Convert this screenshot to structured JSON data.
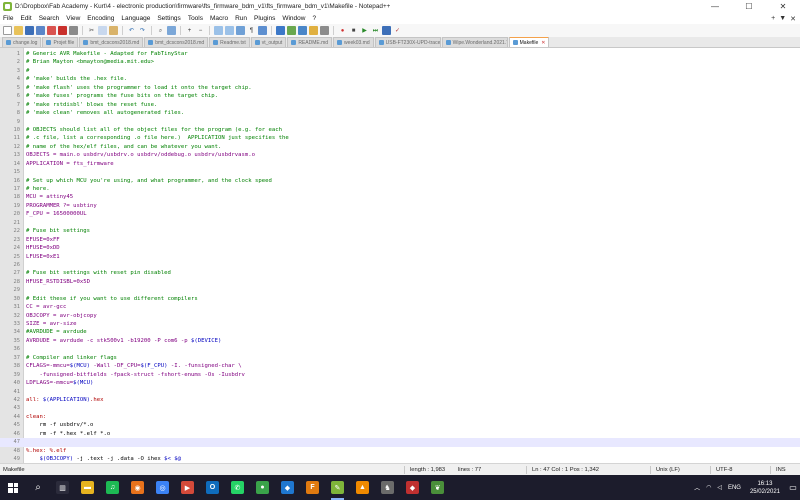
{
  "window": {
    "title": "D:\\Dropbox\\Fab Academy - Kurt\\4 - electronic production\\firmware\\fts_firmware_bdm_v1\\fts_firmware_bdm_v1\\Makefile - Notepad++",
    "minimize": "—",
    "maximize": "☐",
    "close": "✕"
  },
  "menu": {
    "items": [
      "File",
      "Edit",
      "Search",
      "View",
      "Encoding",
      "Language",
      "Settings",
      "Tools",
      "Macro",
      "Run",
      "Plugins",
      "Window",
      "?"
    ],
    "right_plus": "+",
    "right_down": "▼",
    "right_close": "✕"
  },
  "tabs": [
    {
      "label": "change.log",
      "active": false
    },
    {
      "label": "Projet file",
      "active": false
    },
    {
      "label": "bmt_dcscons2018.md",
      "active": false
    },
    {
      "label": "bmt_dcscons2018.md",
      "active": false
    },
    {
      "label": "Readme.txt",
      "active": false
    },
    {
      "label": "vt_output",
      "active": false
    },
    {
      "label": "README.md",
      "active": false
    },
    {
      "label": "week03.md",
      "active": false
    },
    {
      "label": "USB-FT230X-UPD-traces.png (2).md",
      "active": false
    },
    {
      "label": "Wipe.Wonderland.2021.720p.WEBRip.800MB.x264-GalaxyRG.txt",
      "active": false
    },
    {
      "label": "Makefile",
      "active": true
    }
  ],
  "code_lines": [
    {
      "n": "1",
      "text": "# Generic AVR Makefile - Adapted for FabTinyStar",
      "kind": "comment"
    },
    {
      "n": "2",
      "text": "# Brian Mayton <bmayton@media.mit.edu>",
      "kind": "comment"
    },
    {
      "n": "3",
      "text": "#",
      "kind": "comment"
    },
    {
      "n": "4",
      "text": "# 'make' builds the .hex file.",
      "kind": "comment"
    },
    {
      "n": "5",
      "text": "# 'make flash' uses the programmer to load it onto the target chip.",
      "kind": "comment"
    },
    {
      "n": "6",
      "text": "# 'make fuses' programs the fuse bits on the target chip.",
      "kind": "comment"
    },
    {
      "n": "7",
      "text": "# 'make rstdisbl' blows the reset fuse.",
      "kind": "comment"
    },
    {
      "n": "8",
      "text": "# 'make clean' removes all autogenerated files.",
      "kind": "comment"
    },
    {
      "n": "9",
      "text": "",
      "kind": "normal"
    },
    {
      "n": "10",
      "text": "# OBJECTS should list all of the object files for the program (e.g. for each",
      "kind": "comment"
    },
    {
      "n": "11",
      "text": "# .c file, list a corresponding .o file here.)  APPLICATION just specifies the",
      "kind": "comment"
    },
    {
      "n": "12",
      "text": "# name of the hex/elf files, and can be whatever you want.",
      "kind": "comment"
    },
    {
      "n": "13",
      "text": "OBJECTS = main.o usbdrv/usbdrv.o usbdrv/oddebug.o usbdrv/usbdrvasm.o",
      "kind": "var"
    },
    {
      "n": "14",
      "text": "APPLICATION = fts_firmware",
      "kind": "var"
    },
    {
      "n": "15",
      "text": "",
      "kind": "normal"
    },
    {
      "n": "16",
      "text": "# Set up which MCU you're using, and what programmer, and the clock speed",
      "kind": "comment"
    },
    {
      "n": "17",
      "text": "# here.",
      "kind": "comment"
    },
    {
      "n": "18",
      "text": "MCU = attiny45",
      "kind": "var"
    },
    {
      "n": "19",
      "text": "PROGRAMMER ?= usbtiny",
      "kind": "var"
    },
    {
      "n": "20",
      "text": "F_CPU = 16500000UL",
      "kind": "var"
    },
    {
      "n": "21",
      "text": "",
      "kind": "normal"
    },
    {
      "n": "22",
      "text": "# Fuse bit settings",
      "kind": "comment"
    },
    {
      "n": "23",
      "text": "EFUSE=0xFF",
      "kind": "var"
    },
    {
      "n": "24",
      "text": "HFUSE=0xDD",
      "kind": "var"
    },
    {
      "n": "25",
      "text": "LFUSE=0xE1",
      "kind": "var"
    },
    {
      "n": "26",
      "text": "",
      "kind": "normal"
    },
    {
      "n": "27",
      "text": "# Fuse bit settings with reset pin disabled",
      "kind": "comment"
    },
    {
      "n": "28",
      "text": "HFUSE_RSTDISBL=0x5D",
      "kind": "var"
    },
    {
      "n": "29",
      "text": "",
      "kind": "normal"
    },
    {
      "n": "30",
      "text": "# Edit these if you want to use different compilers",
      "kind": "comment"
    },
    {
      "n": "31",
      "text": "CC = avr-gcc",
      "kind": "var"
    },
    {
      "n": "32",
      "text": "OBJCOPY = avr-objcopy",
      "kind": "var"
    },
    {
      "n": "33",
      "text": "SIZE = avr-size",
      "kind": "var"
    },
    {
      "n": "34",
      "text": "#AVRDUDE = avrdude",
      "kind": "comment"
    },
    {
      "n": "35",
      "text": "AVRDUDE = avrdude -c stk500v1 -b19200 -P com6 -p $(DEVICE)",
      "kind": "var"
    },
    {
      "n": "36",
      "text": "",
      "kind": "normal"
    },
    {
      "n": "37",
      "text": "# Compiler and linker flags",
      "kind": "comment"
    },
    {
      "n": "38",
      "text": "CFLAGS=-mmcu=$(MCU) -Wall -DF_CPU=$(F_CPU) -I. -funsigned-char \\",
      "kind": "var"
    },
    {
      "n": "39",
      "text": "    -funsigned-bitfields -fpack-struct -fshort-enums -Os -Iusbdrv",
      "kind": "var"
    },
    {
      "n": "40",
      "text": "LDFLAGS=-mmcu=$(MCU)",
      "kind": "var"
    },
    {
      "n": "41",
      "text": "",
      "kind": "normal"
    },
    {
      "n": "42",
      "text": "all: $(APPLICATION).hex",
      "kind": "target"
    },
    {
      "n": "43",
      "text": "",
      "kind": "normal"
    },
    {
      "n": "44",
      "text": "clean:",
      "kind": "target"
    },
    {
      "n": "45",
      "text": "    rm -f usbdrv/*.o",
      "kind": "normal"
    },
    {
      "n": "46",
      "text": "    rm -f *.hex *.elf *.o",
      "kind": "normal"
    },
    {
      "n": "47",
      "text": "",
      "kind": "current"
    },
    {
      "n": "48",
      "text": "%.hex: %.elf",
      "kind": "target"
    },
    {
      "n": "49",
      "text": "    $(OBJCOPY) -j .text -j .data -O ihex $< $@",
      "kind": "normal"
    }
  ],
  "status": {
    "file_type": "Makefile",
    "length": "length : 1,983",
    "lines": "lines : 77",
    "position": "Ln : 47   Col : 1   Pos : 1,342",
    "eol": "Unix (LF)",
    "encoding": "UTF-8",
    "mode": "INS"
  },
  "taskbar": {
    "time": "16:13",
    "date": "25/02/2021",
    "language": "ENG",
    "apps": [
      {
        "name": "task-view",
        "glyph": "▥",
        "color": "#2b2b3b"
      },
      {
        "name": "file-explorer",
        "glyph": "▬",
        "color": "#e6b320"
      },
      {
        "name": "spotify",
        "glyph": "♫",
        "color": "#1db954"
      },
      {
        "name": "firefox",
        "glyph": "◉",
        "color": "#e8721c"
      },
      {
        "name": "chrome",
        "glyph": "◎",
        "color": "#3b82f6"
      },
      {
        "name": "media",
        "glyph": "▶",
        "color": "#d44a3a"
      },
      {
        "name": "outlook",
        "glyph": "O",
        "color": "#0f6cbd"
      },
      {
        "name": "whatsapp",
        "glyph": "✆",
        "color": "#25d366"
      },
      {
        "name": "app-green",
        "glyph": "●",
        "color": "#3aa34a"
      },
      {
        "name": "app-blue",
        "glyph": "◆",
        "color": "#1f77d0"
      },
      {
        "name": "fusion",
        "glyph": "F",
        "color": "#e07a10"
      },
      {
        "name": "notepad-plus-plus",
        "glyph": "✎",
        "color": "#7fb53a"
      },
      {
        "name": "vlc",
        "glyph": "▲",
        "color": "#f08a00"
      },
      {
        "name": "app-chess",
        "glyph": "♞",
        "color": "#6b6b6b"
      },
      {
        "name": "app-diamond",
        "glyph": "◆",
        "color": "#c03030"
      },
      {
        "name": "app-leaf",
        "glyph": "❦",
        "color": "#4a8f3a"
      }
    ]
  }
}
